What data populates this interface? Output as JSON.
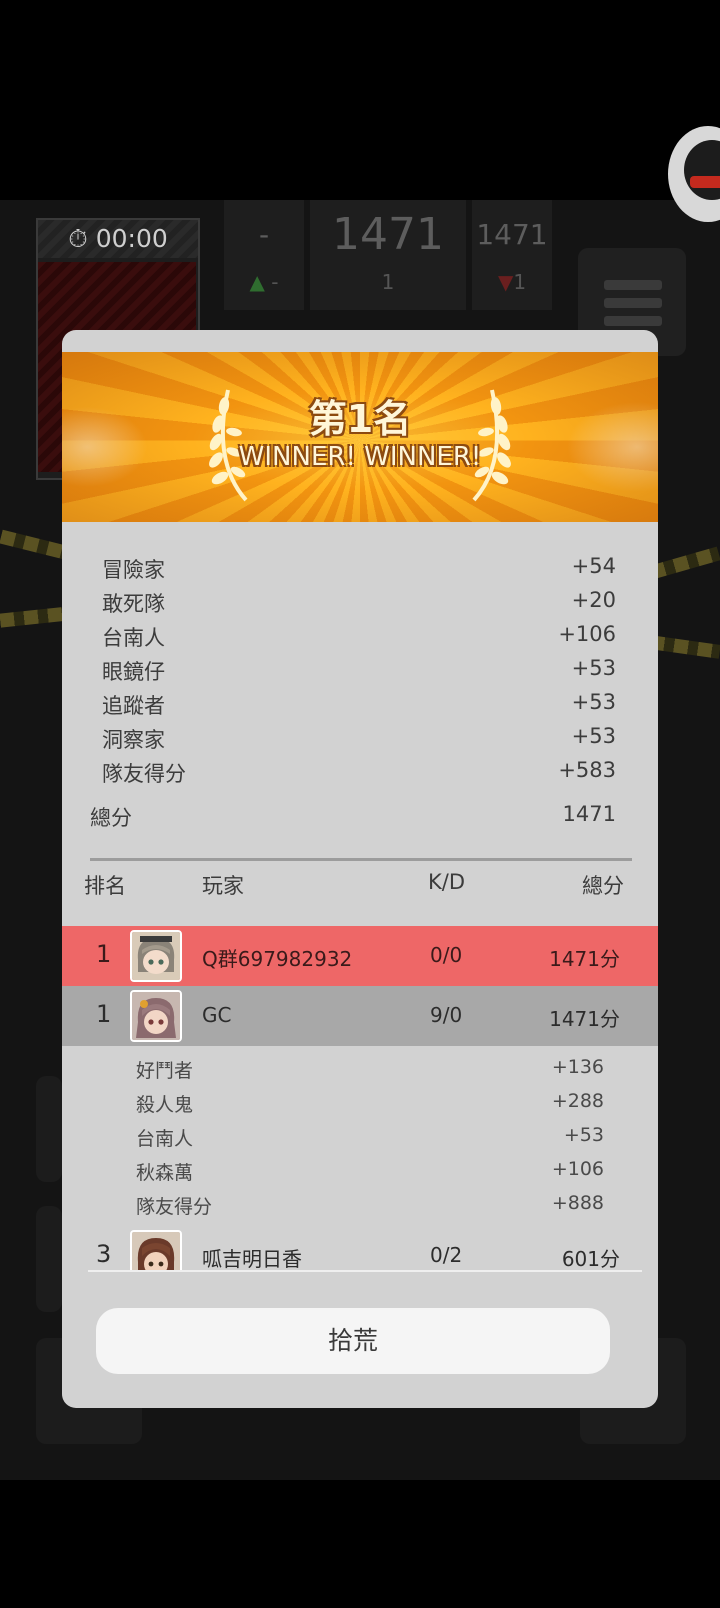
{
  "hud": {
    "timer": "00:00",
    "left_score": "-",
    "left_delta": "-",
    "center_score": "1471",
    "center_rank": "1",
    "right_score": "1471",
    "right_rank": "1"
  },
  "result": {
    "rank_title": "第1名",
    "subtitle": "WINNER! WINNER!",
    "bonuses": [
      {
        "label": "冒險家",
        "value": "+54"
      },
      {
        "label": "敢死隊",
        "value": "+20"
      },
      {
        "label": "台南人",
        "value": "+106"
      },
      {
        "label": "眼鏡仔",
        "value": "+53"
      },
      {
        "label": "追蹤者",
        "value": "+53"
      },
      {
        "label": "洞察家",
        "value": "+53"
      },
      {
        "label": "隊友得分",
        "value": "+583"
      }
    ],
    "total_label": "總分",
    "total_value": "1471"
  },
  "table": {
    "headers": {
      "rank": "排名",
      "player": "玩家",
      "kd": "K/D",
      "score": "總分"
    },
    "players": [
      {
        "rank": "1",
        "name": "Q群697982932",
        "kd": "0/0",
        "score": "1471分",
        "highlight": "#ee6767"
      },
      {
        "rank": "1",
        "name": "GC",
        "kd": "9/0",
        "score": "1471分",
        "highlight": "#a8a8a8"
      },
      {
        "rank": "3",
        "name": "呱吉明日香",
        "kd": "0/2",
        "score": "601分",
        "highlight": ""
      }
    ],
    "gc_details": [
      {
        "label": "好鬥者",
        "value": "+136"
      },
      {
        "label": "殺人鬼",
        "value": "+288"
      },
      {
        "label": "台南人",
        "value": "+53"
      },
      {
        "label": "秋森萬",
        "value": "+106"
      },
      {
        "label": "隊友得分",
        "value": "+888"
      }
    ]
  },
  "action": {
    "label": "拾荒"
  },
  "colors": {
    "modal_bg": "#d2d2d2",
    "self_row": "#ee6767",
    "teammate_row": "#a8a8a8",
    "banner_orange": "#f29410"
  }
}
